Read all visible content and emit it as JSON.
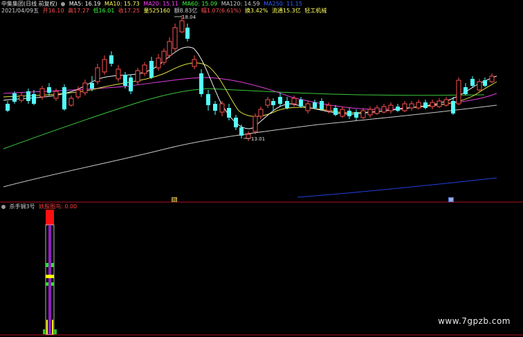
{
  "header": {
    "title": "中集集团(日线 前复权)",
    "ma5": "MA5: 16.19",
    "ma10": "MA10: 15.73",
    "ma20": "MA20: 15.11",
    "ma60": "MA60: 15.09",
    "ma120": "MA120: 14.59",
    "ma250": "MA250: 11.15",
    "date": "2021/04/09五",
    "open": "开16.10",
    "high": "高17.27",
    "low": "低16.01",
    "close": "收17.25",
    "volume": "量525160",
    "amount": "额8.83亿",
    "change": "幅1.07(6.61%)",
    "turnover": "换3.42%",
    "float_mv": "流通15.3亿",
    "sector": "轻工机械"
  },
  "main_chart": {
    "high_label": "18.04",
    "low_label": "13.01",
    "marker_left": "融",
    "marker_right": "财"
  },
  "indicator": {
    "name": "杀手锏3号",
    "value_label": "妖股图鸟: 0.00"
  },
  "watermark": "www.7gpzb.com",
  "colors": {
    "background": "#000000",
    "up": "#ff5050",
    "down": "#54ffff",
    "ma5": "#ffffff",
    "ma10": "#ffff00",
    "ma20": "#ff40ff",
    "ma60": "#40ff40",
    "ma120": "#d0d0d0",
    "ma250": "#3050ff",
    "divider": "#b01020"
  }
}
